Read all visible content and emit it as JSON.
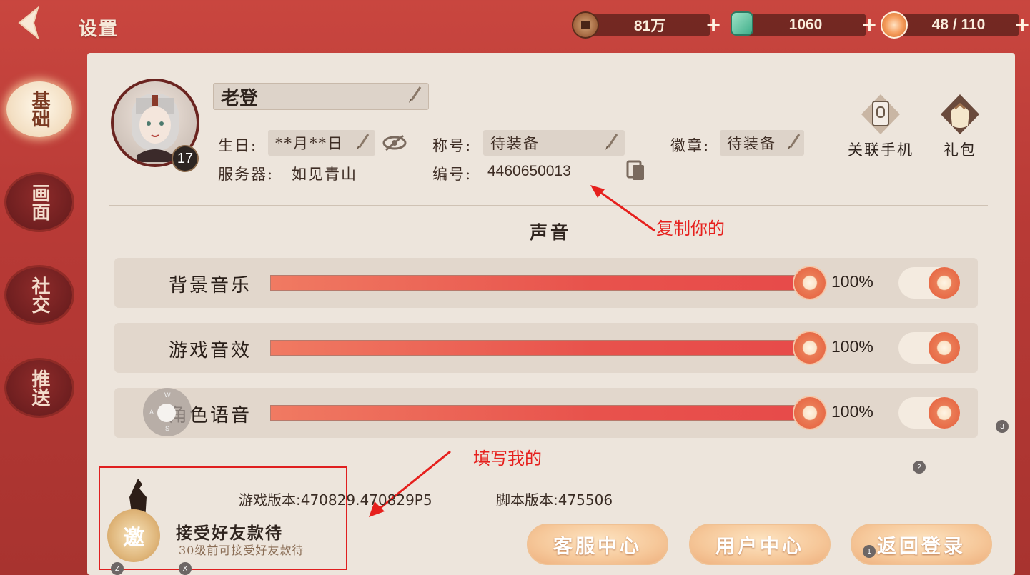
{
  "header": {
    "title": "设置",
    "currencies": [
      {
        "icon": "copper-coin-icon",
        "value": "81万"
      },
      {
        "icon": "jade-icon",
        "value": "1060"
      },
      {
        "icon": "food-stamina-icon",
        "value": "48 / 110"
      }
    ]
  },
  "sidebar": {
    "items": [
      {
        "label": "基础",
        "active": true
      },
      {
        "label": "画面",
        "active": false
      },
      {
        "label": "社交",
        "active": false
      },
      {
        "label": "推送",
        "active": false
      }
    ]
  },
  "profile": {
    "name": "老登",
    "level": "17",
    "birthday_label": "生日:",
    "birthday_value": "**月**日",
    "title_label": "称号:",
    "title_value": "待装备",
    "badge_label": "徽章:",
    "badge_value": "待装备",
    "server_label": "服务器:",
    "server_value": "如见青山",
    "id_label": "编号:",
    "id_value": "4460650013"
  },
  "actions": {
    "link_phone": "关联手机",
    "gift": "礼包"
  },
  "sound": {
    "section_title": "声音",
    "rows": [
      {
        "label": "背景音乐",
        "value": "100%",
        "level": 1.0,
        "enabled": true
      },
      {
        "label": "游戏音效",
        "value": "100%",
        "level": 1.0,
        "enabled": true
      },
      {
        "label": "角色语音",
        "value": "100%",
        "level": 1.0,
        "enabled": true
      }
    ]
  },
  "version": {
    "game": "游戏版本:470829.470829P5",
    "script": "脚本版本:475506"
  },
  "buttons": {
    "support": "客服中心",
    "user_center": "用户中心",
    "return_login": "返回登录"
  },
  "invite": {
    "seal": "邀",
    "title": "接受好友款待",
    "subtitle": "30级前可接受好友款待"
  },
  "annotations": {
    "copy_yours": "复制你的",
    "fill_mine": "填写我的"
  },
  "joystick": {
    "w": "W",
    "a": "A",
    "s": "S"
  },
  "hints": [
    "1",
    "2",
    "3",
    "Z",
    "X"
  ],
  "colors": {
    "accent_red": "#e8524c",
    "annotation_red": "#e6201d",
    "panel_bg": "#ede5dc"
  }
}
